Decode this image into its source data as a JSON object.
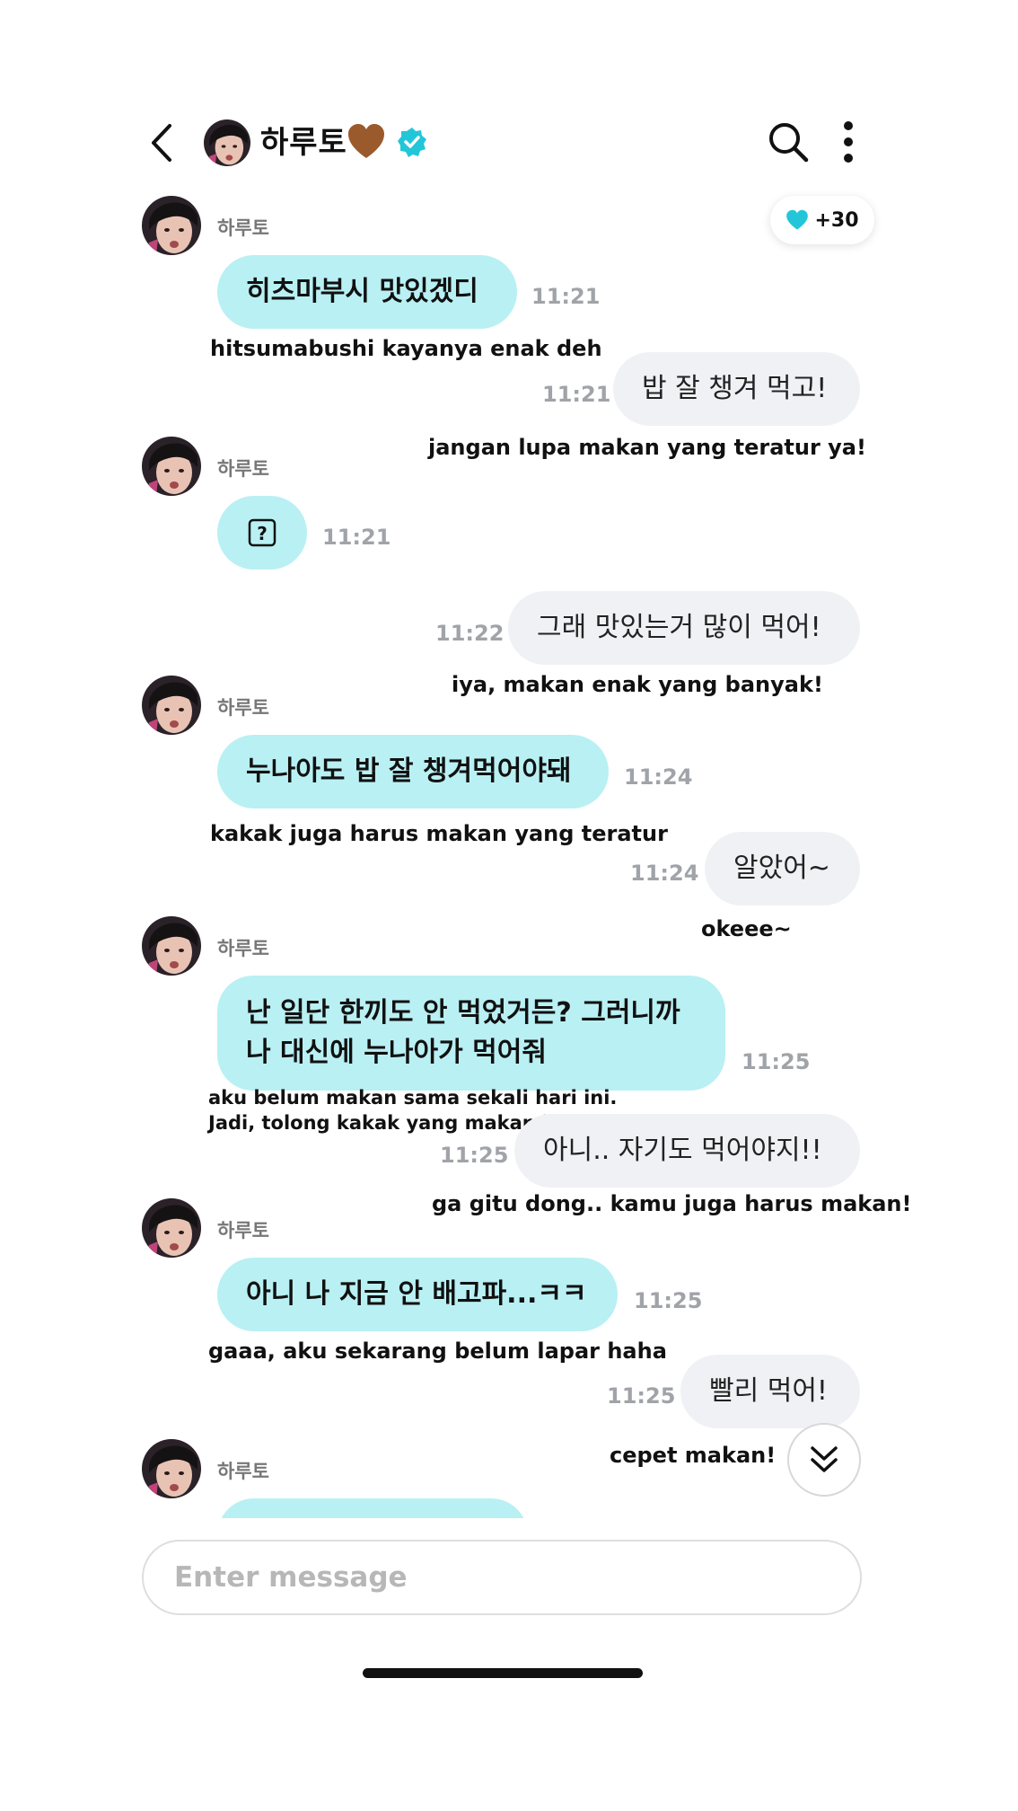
{
  "header": {
    "name": "하루토",
    "heart_icon": "brown-heart-icon",
    "badge_icon": "verified-badge-icon",
    "accent": "#23c6d9"
  },
  "reaction": {
    "label": "+30",
    "icon": "cyan-heart-icon"
  },
  "messages": [
    {
      "sender": "하루토",
      "text": "히츠마부시 맛있겠디",
      "time": "11:21",
      "translation": "hitsumabushi kayanya enak deh"
    },
    {
      "text": "밥 잘 챙겨 먹고!",
      "time": "11:21",
      "translation": "jangan lupa makan yang teratur ya!"
    },
    {
      "sender": "하루토",
      "icon": "question-box-icon",
      "time": "11:21"
    },
    {
      "text": "그래 맛있는거 많이 먹어!",
      "time": "11:22",
      "translation": "iya, makan enak yang banyak!"
    },
    {
      "sender": "하루토",
      "text": "누나아도 밥 잘 챙겨먹어야돼",
      "time": "11:24",
      "translation": "kakak juga harus makan yang teratur"
    },
    {
      "text": "알았어~",
      "time": "11:24",
      "translation": "okeee~"
    },
    {
      "sender": "하루토",
      "text_line1": "난 일단 한끼도 안 먹었거든? 그러니까",
      "text_line2": "나 대신에 누나아가 먹어줘",
      "time": "11:25",
      "translation_line1": "aku belum makan sama sekali hari ini.",
      "translation_line2": "Jadi, tolong kakak yang makan buat gantiin aku ya"
    },
    {
      "text": "아니.. 자기도 먹어야지!!",
      "time": "11:25",
      "translation": "ga gitu dong.. kamu juga harus makan!"
    },
    {
      "sender": "하루토",
      "text": "아니 나 지금 안 배고파...ㅋㅋ",
      "time": "11:25",
      "translation": "gaaa, aku sekarang belum lapar haha"
    },
    {
      "text": "빨리 먹어!",
      "time": "11:25",
      "translation": "cepet makan!"
    },
    {
      "sender": "하루토"
    }
  ],
  "composer": {
    "placeholder": "Enter message"
  }
}
